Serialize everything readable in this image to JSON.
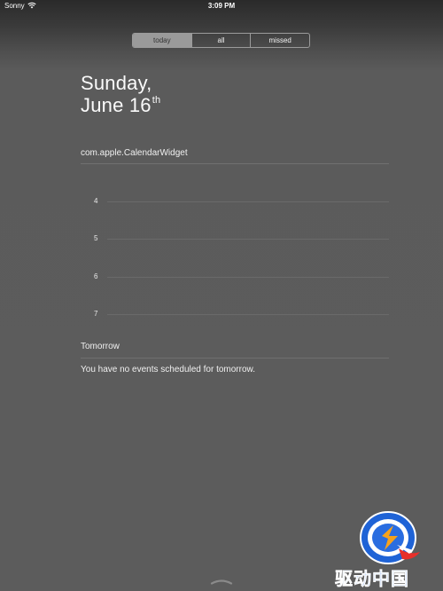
{
  "status_bar": {
    "carrier": "Sonny",
    "time": "3:09 PM",
    "wifi_icon": "wifi-icon"
  },
  "tabs": [
    {
      "label": "today",
      "selected": true
    },
    {
      "label": "all",
      "selected": false
    },
    {
      "label": "missed",
      "selected": false
    }
  ],
  "date": {
    "day": "Sunday,",
    "month_day": "June 16",
    "suffix": "th"
  },
  "widget": {
    "title": "com.apple.CalendarWidget",
    "hours": [
      "4",
      "5",
      "6",
      "7"
    ]
  },
  "tomorrow": {
    "title": "Tomorrow",
    "message": "You have no events scheduled for tomorrow."
  },
  "grabber": {
    "icon": "chevron-handle-icon"
  },
  "watermark": {
    "text": "驱动中国",
    "logo_icon": "q-logo-icon"
  },
  "colors": {
    "background": "#5c5c5c",
    "selected_segment": "#9a9a9a",
    "watermark_blue": "#2a6de0"
  }
}
